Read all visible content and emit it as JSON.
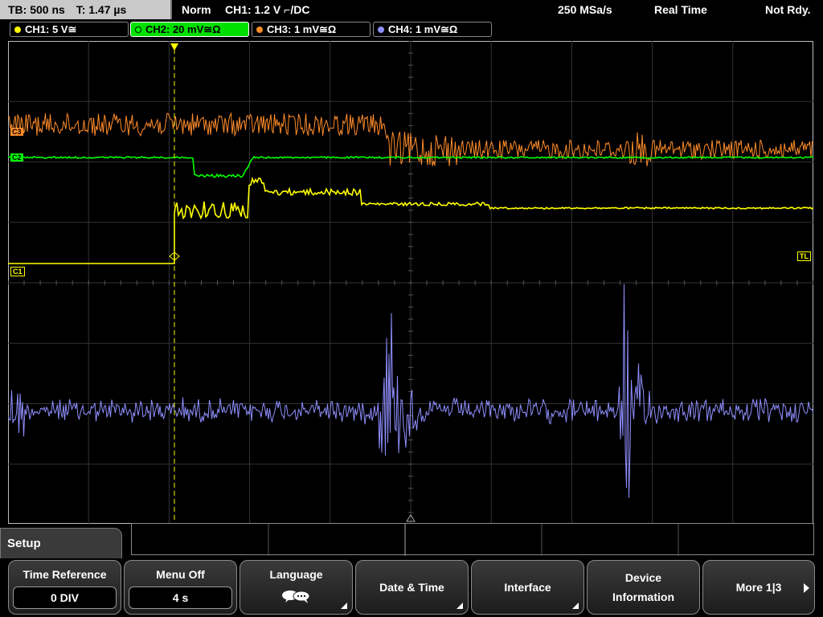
{
  "status": {
    "timebase": "TB: 500 ns",
    "trigger_time": "T: 1.47 µs",
    "mode": "Norm",
    "trigger_info": "CH1: 1.2 V ⌐/DC",
    "sample_rate": "250 MSa/s",
    "acq_mode": "Real Time",
    "ready_state": "Not Rdy."
  },
  "channels": [
    {
      "label": "CH1: 5 V≅",
      "color": "#ffff00",
      "active": false
    },
    {
      "label": "CH2: 20 mV≅Ω",
      "color": "#00ff00",
      "active": true
    },
    {
      "label": "CH3: 1 mV≅Ω",
      "color": "#ff8c2a",
      "active": false
    },
    {
      "label": "CH4: 1 mV≅Ω",
      "color": "#8f8fff",
      "active": false
    }
  ],
  "markers": {
    "ch1_ref": "C1",
    "ch2_ref": "C2",
    "ch3_ref": "C3",
    "trigger_level": "TL"
  },
  "menu": {
    "title": "Setup",
    "softkeys": [
      {
        "label": "Time Reference",
        "value": "0 DIV"
      },
      {
        "label": "Menu Off",
        "value": "4 s"
      },
      {
        "label": "Language",
        "icon": "speech-bubbles-icon"
      },
      {
        "label": "Date & Time"
      },
      {
        "label": "Interface"
      },
      {
        "label": "Device",
        "label2": "Information"
      },
      {
        "label": "More 1|3"
      }
    ]
  }
}
